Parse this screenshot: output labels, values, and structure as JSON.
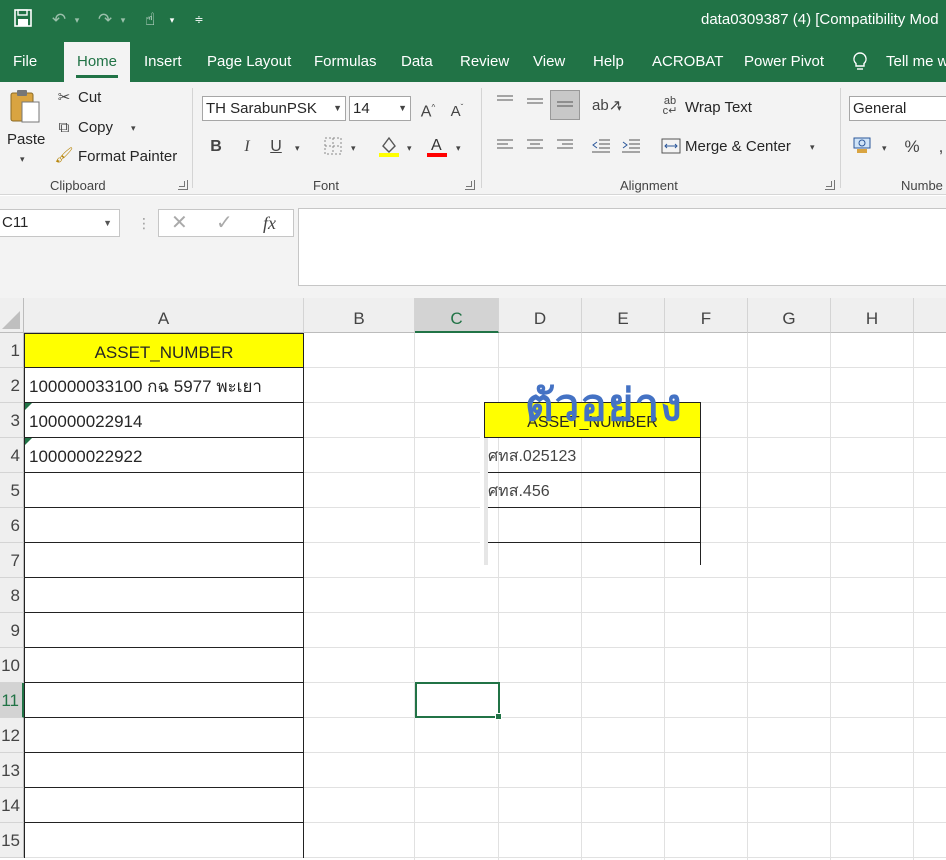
{
  "window": {
    "title": "data0309387 (4)  [Compatibility Mod"
  },
  "tabs": [
    "File",
    "Home",
    "Insert",
    "Page Layout",
    "Formulas",
    "Data",
    "Review",
    "View",
    "Help",
    "ACROBAT",
    "Power Pivot",
    "Tell me w"
  ],
  "clipboard": {
    "paste": "Paste",
    "cut": "Cut",
    "copy": "Copy",
    "format_painter": "Format Painter",
    "label": "Clipboard"
  },
  "font": {
    "name": "TH SarabunPSK",
    "size": "14",
    "bold": "B",
    "italic": "I",
    "underline": "U",
    "label": "Font",
    "fill_color": "#ffff00",
    "font_color": "#ff0000"
  },
  "alignment": {
    "wrap_text": "Wrap Text",
    "merge_center": "Merge & Center",
    "label": "Alignment"
  },
  "number": {
    "format": "General",
    "percent": "%",
    "label": "Numbe"
  },
  "formula_bar": {
    "name_box": "C11",
    "fx": "fx",
    "value": ""
  },
  "sheet": {
    "columns": [
      "A",
      "B",
      "C",
      "D",
      "E",
      "F",
      "G",
      "H"
    ],
    "selected_column": "C",
    "rows": [
      "1",
      "2",
      "3",
      "4",
      "5",
      "6",
      "7",
      "8",
      "9",
      "10",
      "11",
      "12",
      "13",
      "14",
      "15"
    ],
    "selected_row": "11",
    "col_a_cells": [
      "ASSET_NUMBER",
      "100000033100 กฉ 5977 พะเยา",
      "100000022914",
      "100000022922"
    ],
    "header_fill": "#ffff00"
  },
  "sample": {
    "title": "ตัวอย่าง",
    "header": "ASSET_NUMBER",
    "rows": [
      "ศทส.025123",
      "ศทส.456",
      "",
      ""
    ]
  }
}
